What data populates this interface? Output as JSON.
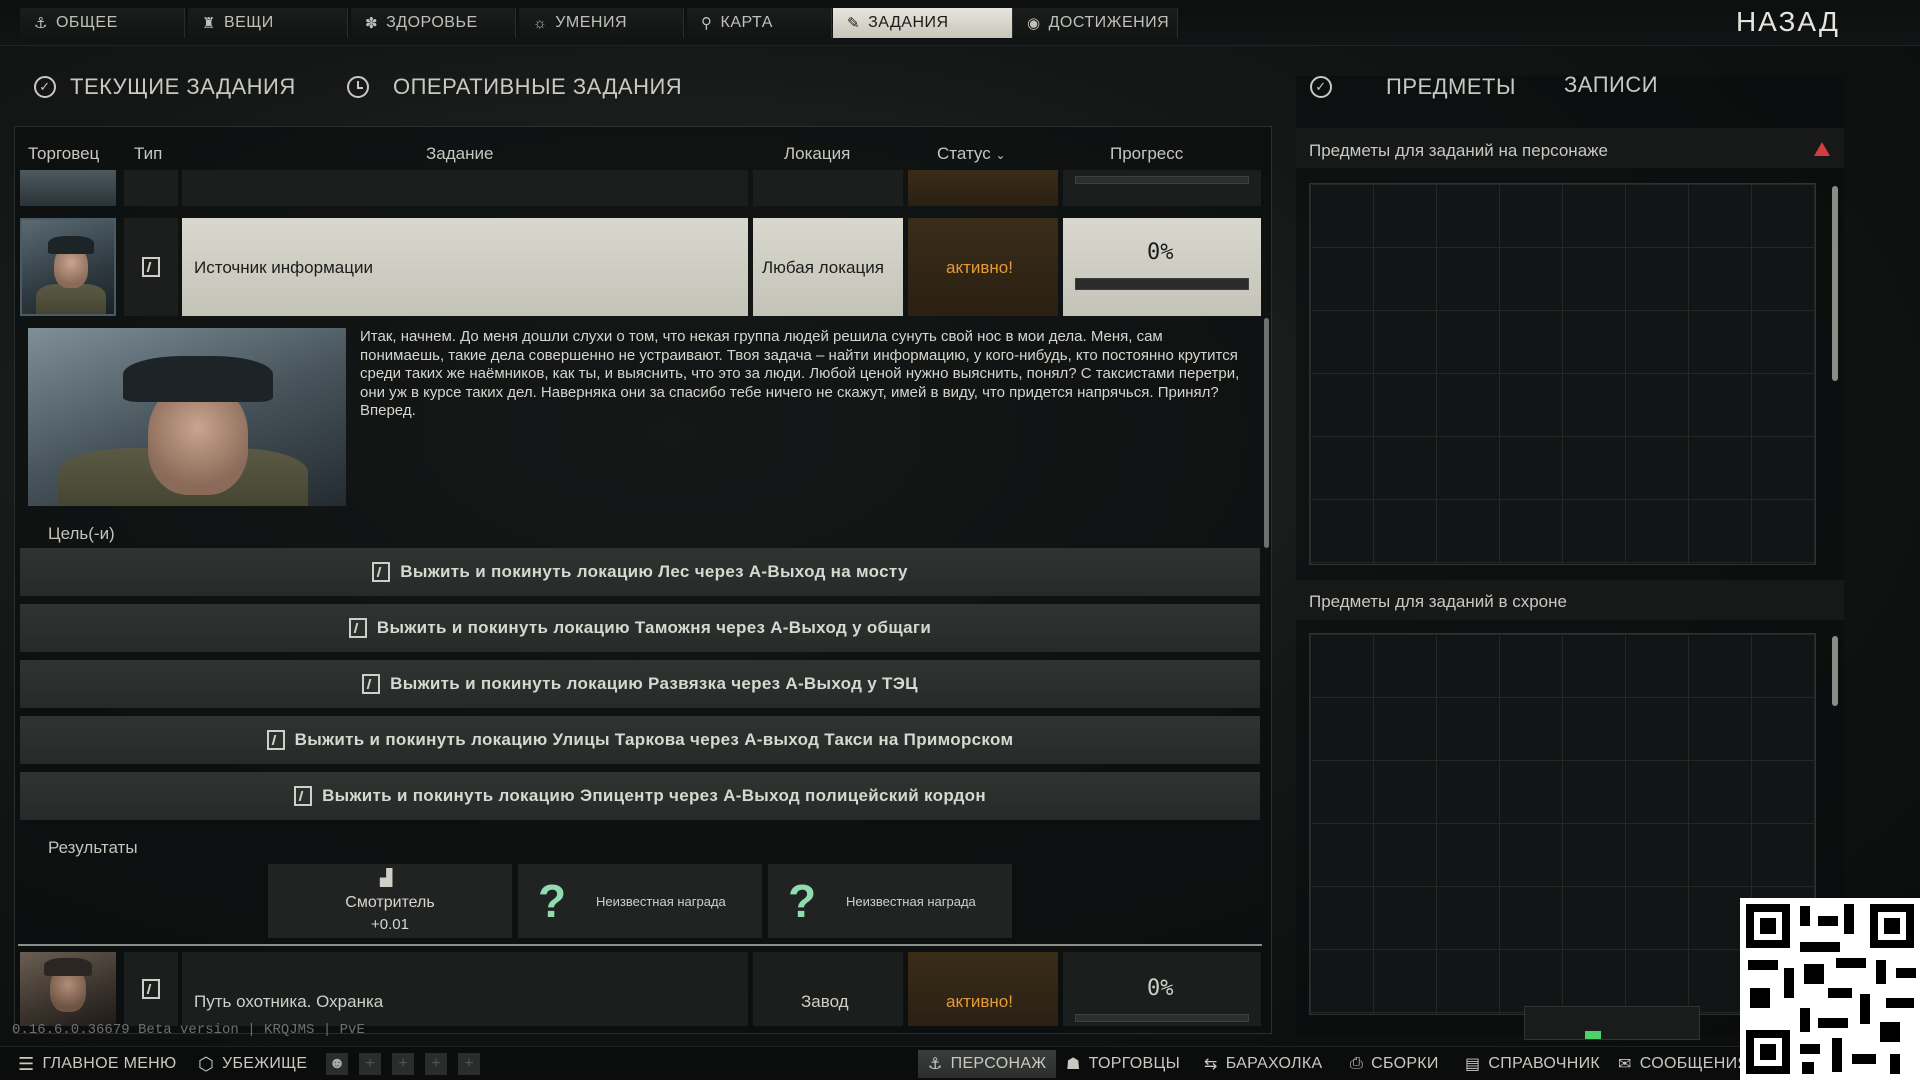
{
  "nav": {
    "tabs": [
      {
        "label": "ОБЩЕЕ",
        "icon": "character-icon"
      },
      {
        "label": "ВЕЩИ",
        "icon": "gear-icon"
      },
      {
        "label": "ЗДОРОВЬЕ",
        "icon": "health-icon"
      },
      {
        "label": "УМЕНИЯ",
        "icon": "skills-icon"
      },
      {
        "label": "КАРТА",
        "icon": "map-pin-icon"
      },
      {
        "label": "ЗАДАНИЯ",
        "icon": "tasks-icon"
      },
      {
        "label": "ДОСТИЖЕНИЯ",
        "icon": "achievements-icon"
      }
    ],
    "active_tab": "ЗАДАНИЯ",
    "back_label": "НАЗАД"
  },
  "left_header": {
    "current_tasks_label": "ТЕКУЩИЕ ЗАДАНИЯ",
    "operational_tasks_label": "ОПЕРАТИВНЫЕ ЗАДАНИЯ"
  },
  "right_header": {
    "items_label": "ПРЕДМЕТЫ",
    "notes_label": "ЗАПИСИ"
  },
  "table": {
    "columns": {
      "trader": "Торговец",
      "type": "Тип",
      "task": "Задание",
      "location": "Локация",
      "status": "Статус",
      "progress": "Прогресс"
    }
  },
  "quests": [
    {
      "name": "Источник информации",
      "location": "Любая локация",
      "status": "активно!",
      "progress_text": "0%",
      "progress": 0
    },
    {
      "name": "Путь охотника. Охранка",
      "location": "Завод",
      "status": "активно!",
      "progress_text": "0%",
      "progress": 0
    }
  ],
  "details": {
    "description": "Итак, начнем. До меня дошли слухи о том, что некая группа людей решила сунуть свой нос в мои дела. Меня, сам понимаешь, такие дела совершенно не устраивают. Твоя задача – найти информацию, у кого-нибудь, кто постоянно крутится среди таких же наёмников, как ты, и выяснить, что это за люди. Любой ценой нужно выяснить, понял? С таксистами перетри, они уж в курсе таких дел. Наверняка они за спасибо тебе ничего не скажут, имей в виду, что придется напрячься. Принял? Вперед.",
    "objectives_label": "Цель(-и)",
    "objectives": [
      "Выжить и покинуть локацию Лес через А-Выход на мосту",
      "Выжить и покинуть локацию Таможня через А-Выход у общаги",
      "Выжить и покинуть локацию Развязка через А-Выход у ТЭЦ",
      "Выжить и покинуть локацию Улицы Таркова через А-выход Такси на Приморском",
      "Выжить и покинуть локацию Эпицентр через А-Выход полицейский кордон"
    ],
    "results_label": "Результаты",
    "rewards": {
      "rep_name": "Смотритель",
      "rep_value": "+0.01",
      "unknown_1": "Неизвестная награда",
      "unknown_2": "Неизвестная награда"
    }
  },
  "right_panel": {
    "on_character_title": "Предметы для заданий на персонаже",
    "in_stash_title": "Предметы для заданий в схроне"
  },
  "version_text": "0.16.6.0.36679 Beta version | KRQJMS | PvE",
  "bottom_bar": {
    "main_menu": "ГЛАВНОЕ МЕНЮ",
    "hideout": "УБЕЖИЩЕ",
    "character": "ПЕРСОНАЖ",
    "traders": "ТОРГОВЦЫ",
    "flea": "БАРАХОЛКА",
    "builds": "СБОРКИ",
    "handbook": "СПРАВОЧНИК",
    "messages": "СООБЩЕНИЯ"
  },
  "colors": {
    "accent_active": "#e8e6dc",
    "status_orange": "#e49a3c",
    "reward_green": "#8fdcb0",
    "warning_red": "#d43b3b"
  }
}
